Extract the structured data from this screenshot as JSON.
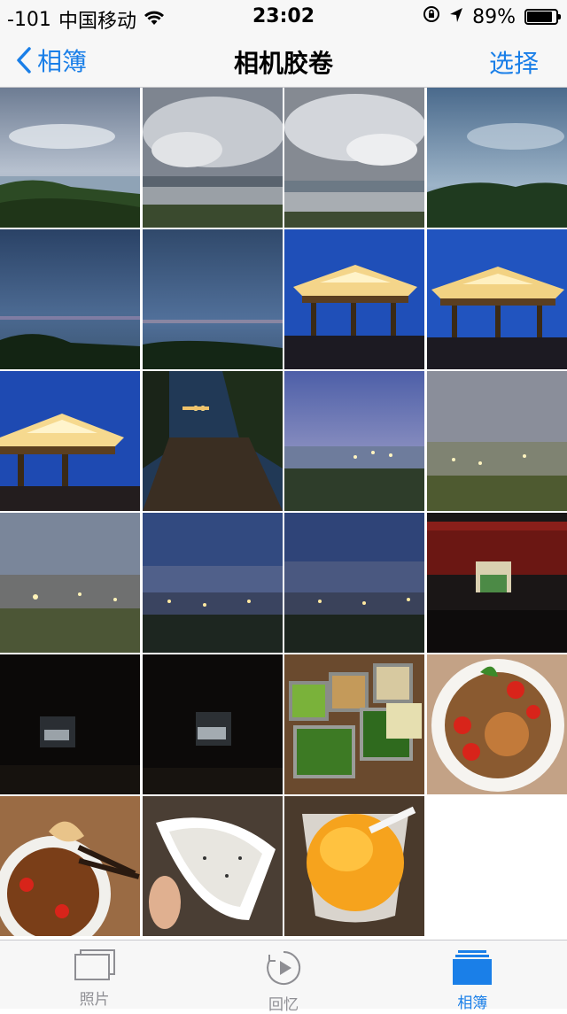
{
  "status_bar": {
    "signal": "-101",
    "carrier": "中国移动",
    "time": "23:02",
    "battery": "89%",
    "battery_level": 0.89,
    "wifi_icon": "wifi-icon",
    "lock_icon": "orientation-lock-icon",
    "location_icon": "location-arrow-icon"
  },
  "nav": {
    "back_label": "相簿",
    "title": "相机胶卷",
    "select_label": "选择",
    "accent": "#1a7fe8"
  },
  "photos": [
    {
      "subject": "coastal view cloudy sky"
    },
    {
      "subject": "storm clouds over city"
    },
    {
      "subject": "storm clouds over bay city"
    },
    {
      "subject": "dusk sea with green hills"
    },
    {
      "subject": "blue dusk sea and islands"
    },
    {
      "subject": "blue dusk sea and islands"
    },
    {
      "subject": "illuminated pavilion at dusk"
    },
    {
      "subject": "illuminated pavilion at dusk"
    },
    {
      "subject": "illuminated pavilion close"
    },
    {
      "subject": "wooden boardwalk with lights"
    },
    {
      "subject": "city lights at dusk"
    },
    {
      "subject": "city lights at dusk"
    },
    {
      "subject": "city lights blurry"
    },
    {
      "subject": "city lights panorama"
    },
    {
      "subject": "city lights panorama"
    },
    {
      "subject": "red building at night"
    },
    {
      "subject": "dark night scene"
    },
    {
      "subject": "dark night scene"
    },
    {
      "subject": "condiment trays"
    },
    {
      "subject": "salad bowl with tomatoes"
    },
    {
      "subject": "dumpling with sauce"
    },
    {
      "subject": "rice cake on plate"
    },
    {
      "subject": "mango dessert cup"
    }
  ],
  "tabs": [
    {
      "label": "照片",
      "icon": "photos-icon",
      "active": false
    },
    {
      "label": "回忆",
      "icon": "memories-icon",
      "active": false
    },
    {
      "label": "相簿",
      "icon": "albums-icon",
      "active": true
    }
  ]
}
